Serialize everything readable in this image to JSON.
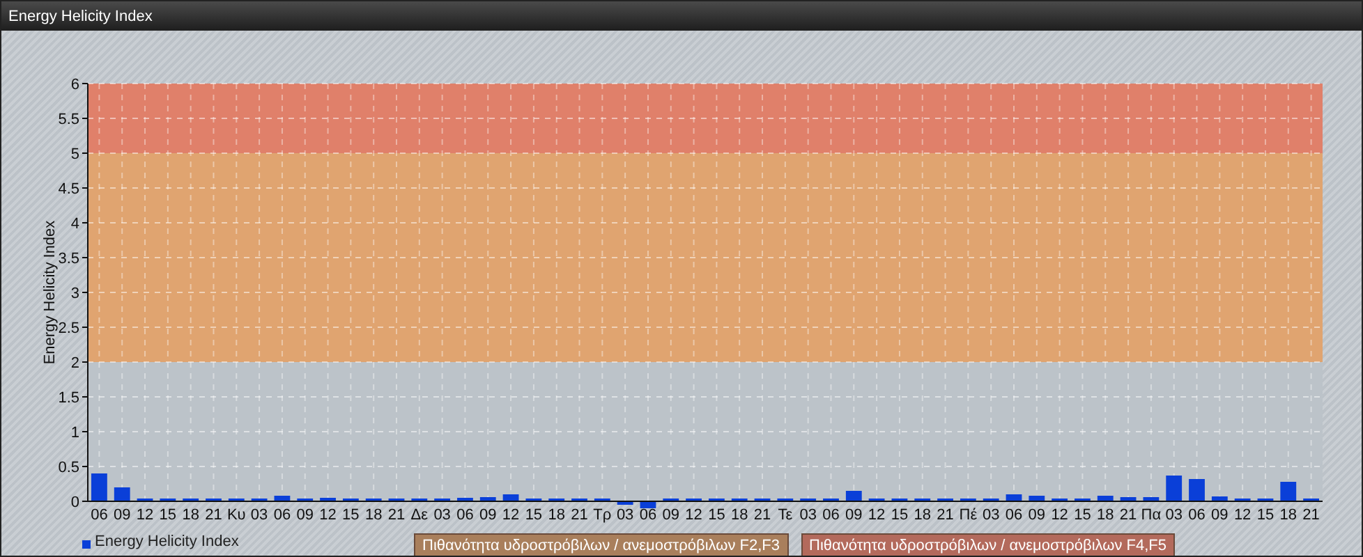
{
  "window": {
    "title": "Energy Helicity Index"
  },
  "chart": {
    "chart_data": {
      "type": "bar",
      "ylabel": "Energy Helicity Index",
      "grid": true,
      "categories": [
        "06",
        "09",
        "12",
        "15",
        "18",
        "21",
        "Κυ",
        "03",
        "06",
        "09",
        "12",
        "15",
        "18",
        "21",
        "Δε",
        "03",
        "06",
        "09",
        "12",
        "15",
        "18",
        "21",
        "Τρ",
        "03",
        "06",
        "09",
        "12",
        "15",
        "18",
        "21",
        "Τε",
        "03",
        "06",
        "09",
        "12",
        "15",
        "18",
        "21",
        "Πέ",
        "03",
        "06",
        "09",
        "12",
        "15",
        "18",
        "21",
        "Πα",
        "03",
        "06",
        "09",
        "12",
        "15",
        "18",
        "21"
      ],
      "series": [
        {
          "name": "Energy Helicity Index",
          "color": "#0a3fd8",
          "values": [
            0.4,
            0.2,
            0.04,
            0.04,
            0.04,
            0.04,
            0.04,
            0.04,
            0.08,
            0.04,
            0.05,
            0.04,
            0.04,
            0.04,
            0.04,
            0.04,
            0.05,
            0.06,
            0.1,
            0.04,
            0.04,
            0.04,
            0.04,
            -0.05,
            -0.1,
            0.04,
            0.04,
            0.04,
            0.04,
            0.04,
            0.04,
            0.04,
            0.04,
            0.15,
            0.04,
            0.04,
            0.04,
            0.04,
            0.04,
            0.04,
            0.1,
            0.08,
            0.04,
            0.04,
            0.08,
            0.06,
            0.06,
            0.37,
            0.32,
            0.07,
            0.04,
            0.04,
            0.28,
            0.04
          ]
        }
      ],
      "ylim": [
        -0.15,
        6
      ],
      "yticks": [
        0,
        0.5,
        1,
        1.5,
        2,
        2.5,
        3,
        3.5,
        4,
        4.5,
        5,
        5.5,
        6
      ],
      "bands": [
        {
          "axis": "y",
          "from": 0,
          "to": 2,
          "color": "#bcc3c9"
        },
        {
          "axis": "y",
          "from": 2,
          "to": 5,
          "color": "#e0a470"
        },
        {
          "axis": "y",
          "from": 5,
          "to": 6,
          "color": "#e0806a"
        }
      ]
    }
  },
  "legend": [
    {
      "label": "Πιθανότητα υδροστρόβιλων / ανεμοστρόβιλων F2,F3",
      "color": "#a97f5c"
    },
    {
      "label": "Πιθανότητα υδροστρόβιλων / ανεμοστρόβιλων F4,F5",
      "color": "#b36a5c"
    }
  ]
}
